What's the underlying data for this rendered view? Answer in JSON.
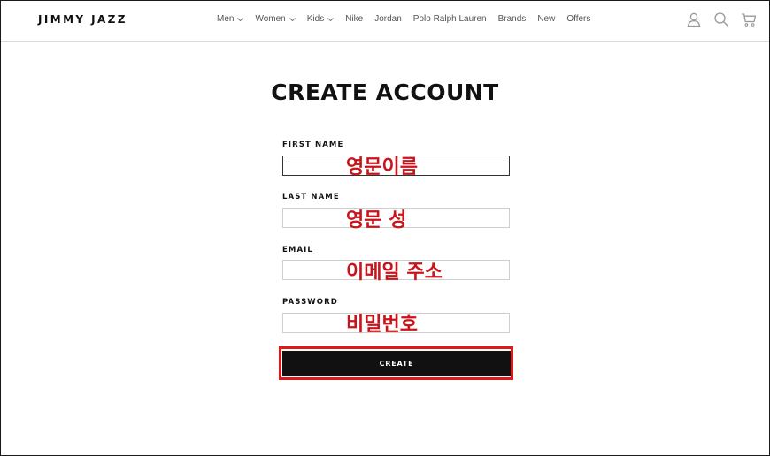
{
  "header": {
    "logo": "JIMMY JAZZ",
    "nav": [
      {
        "label": "Men",
        "has_dropdown": true
      },
      {
        "label": "Women",
        "has_dropdown": true
      },
      {
        "label": "Kids",
        "has_dropdown": true
      },
      {
        "label": "Nike",
        "has_dropdown": false
      },
      {
        "label": "Jordan",
        "has_dropdown": false
      },
      {
        "label": "Polo Ralph Lauren",
        "has_dropdown": false
      },
      {
        "label": "Brands",
        "has_dropdown": false
      },
      {
        "label": "New",
        "has_dropdown": false
      },
      {
        "label": "Offers",
        "has_dropdown": false
      }
    ],
    "icons": [
      "account-icon",
      "search-icon",
      "cart-icon"
    ]
  },
  "main": {
    "title": "CREATE ACCOUNT",
    "fields": [
      {
        "label": "FIRST NAME",
        "value": "",
        "annotation": "영문이름",
        "focused": true
      },
      {
        "label": "LAST NAME",
        "value": "",
        "annotation": "영문 성",
        "focused": false
      },
      {
        "label": "EMAIL",
        "value": "",
        "annotation": "이메일 주소",
        "focused": false
      },
      {
        "label": "PASSWORD",
        "value": "",
        "annotation": "비밀번호",
        "focused": false
      }
    ],
    "create_label": "CREATE"
  },
  "colors": {
    "annotation": "#c8141a",
    "highlight": "#e01818",
    "button_bg": "#111111",
    "nav_text": "#555555"
  }
}
